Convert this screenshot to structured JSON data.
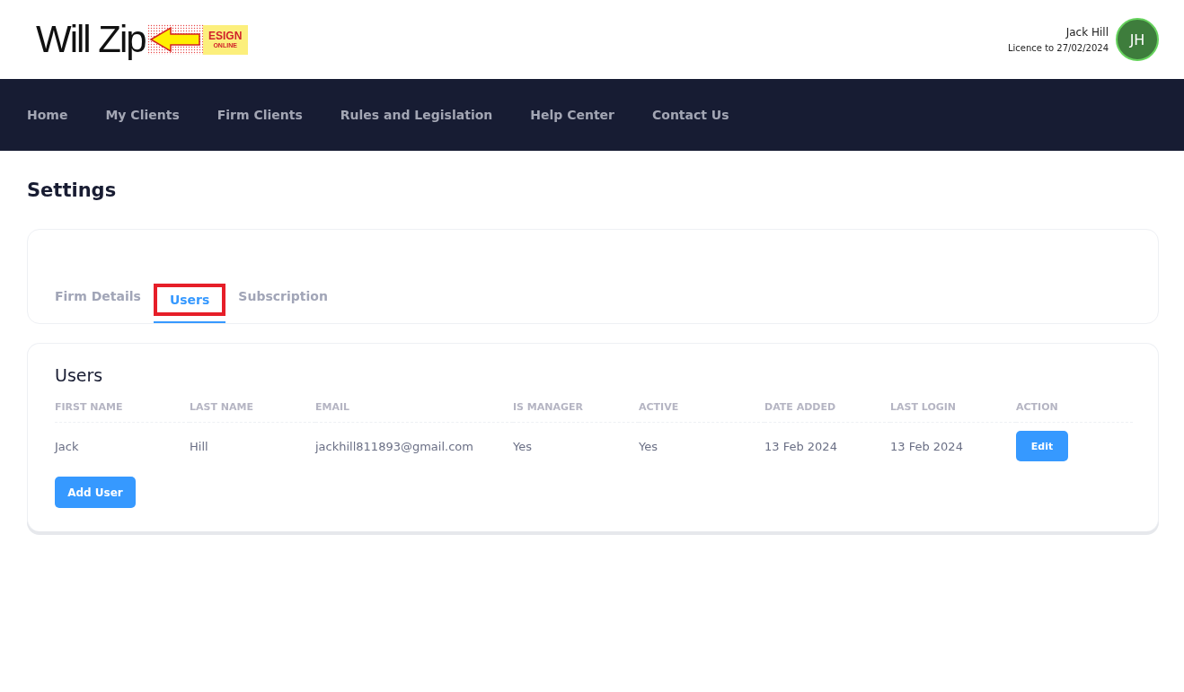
{
  "logo": {
    "wordmark": "Will Zip",
    "badge_title": "ESIGN",
    "badge_subtitle": "ONLINE"
  },
  "user": {
    "name": "Jack Hill",
    "licence": "Licence to 27/02/2024",
    "initials": "JH"
  },
  "nav": [
    {
      "label": "Home"
    },
    {
      "label": "My Clients"
    },
    {
      "label": "Firm Clients"
    },
    {
      "label": "Rules and Legislation"
    },
    {
      "label": "Help Center"
    },
    {
      "label": "Contact Us"
    }
  ],
  "page_title": "Settings",
  "tabs": [
    {
      "label": "Firm Details",
      "selected": false,
      "highlighted": false
    },
    {
      "label": "Users",
      "selected": true,
      "highlighted": true
    },
    {
      "label": "Subscription",
      "selected": false,
      "highlighted": false
    }
  ],
  "users": {
    "title": "Users",
    "columns": [
      "FIRST NAME",
      "LAST NAME",
      "EMAIL",
      "IS MANAGER",
      "ACTIVE",
      "DATE ADDED",
      "LAST LOGIN",
      "ACTION"
    ],
    "rows": [
      {
        "cells": [
          "Jack",
          "Hill",
          "jackhill811893@gmail.com",
          "Yes",
          "Yes",
          "13 Feb 2024",
          "13 Feb 2024"
        ],
        "action": "Edit"
      }
    ],
    "add_button": "Add User"
  }
}
